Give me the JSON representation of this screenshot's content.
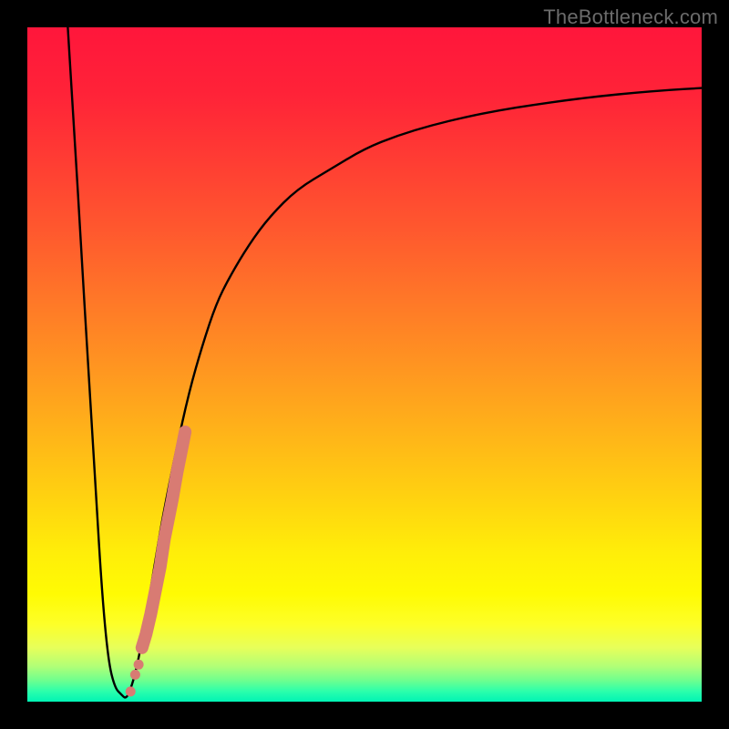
{
  "watermark": {
    "text": "TheBottleneck.com"
  },
  "gradient": {
    "stops": [
      {
        "offset": 0.0,
        "color": "#ff163b"
      },
      {
        "offset": 0.1,
        "color": "#ff2338"
      },
      {
        "offset": 0.2,
        "color": "#ff3d33"
      },
      {
        "offset": 0.3,
        "color": "#ff582e"
      },
      {
        "offset": 0.4,
        "color": "#ff7628"
      },
      {
        "offset": 0.5,
        "color": "#ff9421"
      },
      {
        "offset": 0.6,
        "color": "#ffb319"
      },
      {
        "offset": 0.7,
        "color": "#ffd310"
      },
      {
        "offset": 0.78,
        "color": "#ffee09"
      },
      {
        "offset": 0.84,
        "color": "#fffb03"
      },
      {
        "offset": 0.885,
        "color": "#fdff28"
      },
      {
        "offset": 0.92,
        "color": "#e7ff5a"
      },
      {
        "offset": 0.948,
        "color": "#b0ff77"
      },
      {
        "offset": 0.968,
        "color": "#70ff8e"
      },
      {
        "offset": 0.985,
        "color": "#2affac"
      },
      {
        "offset": 1.0,
        "color": "#00f3b4"
      }
    ]
  },
  "chart_data": {
    "type": "line",
    "title": "",
    "xlabel": "",
    "ylabel": "",
    "xlim": [
      0,
      100
    ],
    "ylim": [
      0,
      100
    ],
    "grid": false,
    "series": [
      {
        "name": "bottleneck-curve",
        "x": [
          6,
          7,
          8,
          9,
          10,
          11,
          12,
          13,
          14,
          14.5,
          15,
          16,
          17,
          18,
          19,
          20,
          22,
          24,
          26,
          28,
          30,
          33,
          36,
          40,
          45,
          50,
          55,
          60,
          65,
          70,
          75,
          80,
          85,
          90,
          95,
          100
        ],
        "y": [
          100,
          84,
          67,
          50,
          34,
          17,
          6,
          2,
          1,
          0.5,
          1,
          4,
          9,
          15,
          21,
          27,
          37,
          46,
          53,
          59,
          63,
          68,
          72,
          76,
          79,
          82,
          84,
          85.5,
          86.7,
          87.7,
          88.5,
          89.2,
          89.8,
          90.3,
          90.7,
          91
        ]
      }
    ],
    "highlight": {
      "name": "highlighted-segment",
      "color": "#d87b73",
      "points": [
        {
          "x": 17.0,
          "y": 8.0
        },
        {
          "x": 17.6,
          "y": 10.0
        },
        {
          "x": 18.3,
          "y": 13.0
        },
        {
          "x": 18.5,
          "y": 14.0
        },
        {
          "x": 19.1,
          "y": 17.0
        },
        {
          "x": 19.7,
          "y": 20.0
        },
        {
          "x": 20.3,
          "y": 24.0
        },
        {
          "x": 20.9,
          "y": 27.0
        },
        {
          "x": 21.5,
          "y": 30.0
        },
        {
          "x": 22.2,
          "y": 34.0
        },
        {
          "x": 22.8,
          "y": 37.0
        },
        {
          "x": 23.4,
          "y": 40.0
        }
      ],
      "extra_dots": [
        {
          "x": 16.0,
          "y": 4.0
        },
        {
          "x": 16.5,
          "y": 5.5
        },
        {
          "x": 15.3,
          "y": 1.5
        }
      ]
    }
  }
}
